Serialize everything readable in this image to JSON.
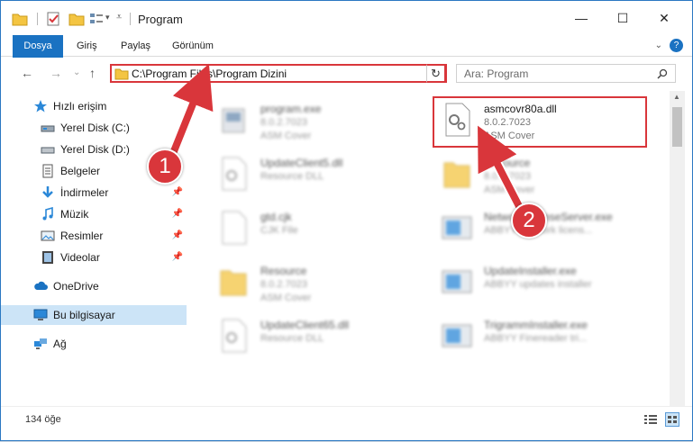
{
  "titlebar": {
    "title": "Program",
    "minimize": "—",
    "maximize": "☐",
    "close": "✕"
  },
  "ribbon": {
    "tabs": [
      "Dosya",
      "Giriş",
      "Paylaş",
      "Görünüm"
    ],
    "help": "?"
  },
  "nav": {
    "back": "←",
    "forward": "→",
    "recent": "⌄",
    "up": "↑",
    "address": "C:\\Program Files\\Program Dizini",
    "refresh": "↻",
    "search_placeholder": "Ara: Program"
  },
  "sidebar": {
    "items": [
      {
        "label": "Hızlı erişim",
        "icon": "star-icon"
      },
      {
        "label": "Yerel Disk (C:)",
        "icon": "drive-icon"
      },
      {
        "label": "Yerel Disk (D:)",
        "icon": "drive-icon"
      },
      {
        "label": "Belgeler",
        "icon": "documents-icon"
      },
      {
        "label": "İndirmeler",
        "icon": "download-icon"
      },
      {
        "label": "Müzik",
        "icon": "music-icon"
      },
      {
        "label": "Resimler",
        "icon": "pictures-icon"
      },
      {
        "label": "Videolar",
        "icon": "video-icon"
      },
      {
        "label": "OneDrive",
        "icon": "cloud-icon"
      },
      {
        "label": "Bu bilgisayar",
        "icon": "computer-icon"
      },
      {
        "label": "Ağ",
        "icon": "network-icon"
      }
    ]
  },
  "files": [
    {
      "name": "program.exe",
      "sub1": "8.0.2.7023",
      "sub2": "ASM Cover"
    },
    {
      "name": "asmcovr80a.dll",
      "sub1": "8.0.2.7023",
      "sub2": "ASM Cover"
    },
    {
      "name": "UpdateClient5.dll",
      "sub1": "Resource DLL",
      "sub2": ""
    },
    {
      "name": "Resource",
      "sub1": "8.0.2.7023",
      "sub2": "ASM Cover"
    },
    {
      "name": "gtd.cjk",
      "sub1": "CJK File",
      "sub2": ""
    },
    {
      "name": "NetworkLicenseServer.exe",
      "sub1": "ABBYY Network licens...",
      "sub2": ""
    },
    {
      "name": "Resource",
      "sub1": "8.0.2.7023",
      "sub2": "ASM Cover"
    },
    {
      "name": "UpdateInstaller.exe",
      "sub1": "ABBYY updates installer",
      "sub2": ""
    },
    {
      "name": "UpdateClient65.dll",
      "sub1": "Resource DLL",
      "sub2": ""
    },
    {
      "name": "TrigrammInstaller.exe",
      "sub1": "ABBYY Finereader tri...",
      "sub2": ""
    }
  ],
  "status": {
    "count": "134 öğe"
  },
  "callouts": [
    "1",
    "2"
  ],
  "colors": {
    "accent": "#1a72c2",
    "highlight": "#d9363b"
  }
}
